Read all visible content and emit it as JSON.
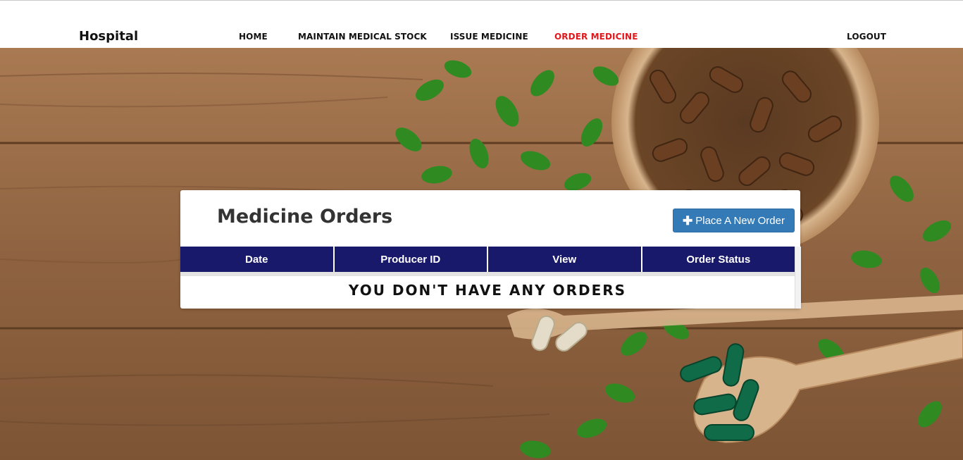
{
  "navbar": {
    "brand": "Hospital",
    "links": [
      {
        "label": "HOME"
      },
      {
        "label": "MAINTAIN MEDICAL STOCK"
      },
      {
        "label": "ISSUE MEDICINE"
      },
      {
        "label": "ORDER MEDICINE",
        "active": true
      },
      {
        "label": "LOGOUT"
      }
    ],
    "active_color": "#e0181b"
  },
  "card": {
    "title": "Medicine Orders",
    "new_order_button": {
      "icon": "plus-icon",
      "label": "Place A New Order"
    },
    "columns": [
      "Date",
      "Producer ID",
      "View",
      "Order Status"
    ],
    "empty_message": "YOU DON'T HAVE ANY ORDERS"
  },
  "colors": {
    "table_header": "#19196b",
    "button": "#337ab7"
  }
}
